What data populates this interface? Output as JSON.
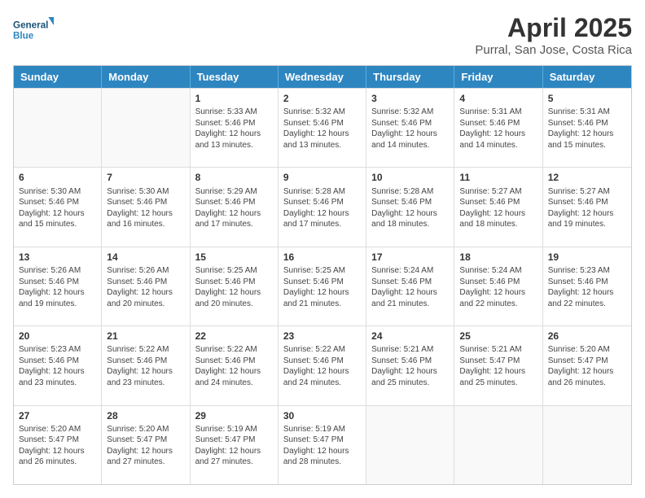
{
  "logo": {
    "line1": "General",
    "line2": "Blue"
  },
  "title": "April 2025",
  "subtitle": "Purral, San Jose, Costa Rica",
  "weekdays": [
    "Sunday",
    "Monday",
    "Tuesday",
    "Wednesday",
    "Thursday",
    "Friday",
    "Saturday"
  ],
  "rows": [
    [
      {
        "day": "",
        "info": ""
      },
      {
        "day": "",
        "info": ""
      },
      {
        "day": "1",
        "info": "Sunrise: 5:33 AM\nSunset: 5:46 PM\nDaylight: 12 hours and 13 minutes."
      },
      {
        "day": "2",
        "info": "Sunrise: 5:32 AM\nSunset: 5:46 PM\nDaylight: 12 hours and 13 minutes."
      },
      {
        "day": "3",
        "info": "Sunrise: 5:32 AM\nSunset: 5:46 PM\nDaylight: 12 hours and 14 minutes."
      },
      {
        "day": "4",
        "info": "Sunrise: 5:31 AM\nSunset: 5:46 PM\nDaylight: 12 hours and 14 minutes."
      },
      {
        "day": "5",
        "info": "Sunrise: 5:31 AM\nSunset: 5:46 PM\nDaylight: 12 hours and 15 minutes."
      }
    ],
    [
      {
        "day": "6",
        "info": "Sunrise: 5:30 AM\nSunset: 5:46 PM\nDaylight: 12 hours and 15 minutes."
      },
      {
        "day": "7",
        "info": "Sunrise: 5:30 AM\nSunset: 5:46 PM\nDaylight: 12 hours and 16 minutes."
      },
      {
        "day": "8",
        "info": "Sunrise: 5:29 AM\nSunset: 5:46 PM\nDaylight: 12 hours and 17 minutes."
      },
      {
        "day": "9",
        "info": "Sunrise: 5:28 AM\nSunset: 5:46 PM\nDaylight: 12 hours and 17 minutes."
      },
      {
        "day": "10",
        "info": "Sunrise: 5:28 AM\nSunset: 5:46 PM\nDaylight: 12 hours and 18 minutes."
      },
      {
        "day": "11",
        "info": "Sunrise: 5:27 AM\nSunset: 5:46 PM\nDaylight: 12 hours and 18 minutes."
      },
      {
        "day": "12",
        "info": "Sunrise: 5:27 AM\nSunset: 5:46 PM\nDaylight: 12 hours and 19 minutes."
      }
    ],
    [
      {
        "day": "13",
        "info": "Sunrise: 5:26 AM\nSunset: 5:46 PM\nDaylight: 12 hours and 19 minutes."
      },
      {
        "day": "14",
        "info": "Sunrise: 5:26 AM\nSunset: 5:46 PM\nDaylight: 12 hours and 20 minutes."
      },
      {
        "day": "15",
        "info": "Sunrise: 5:25 AM\nSunset: 5:46 PM\nDaylight: 12 hours and 20 minutes."
      },
      {
        "day": "16",
        "info": "Sunrise: 5:25 AM\nSunset: 5:46 PM\nDaylight: 12 hours and 21 minutes."
      },
      {
        "day": "17",
        "info": "Sunrise: 5:24 AM\nSunset: 5:46 PM\nDaylight: 12 hours and 21 minutes."
      },
      {
        "day": "18",
        "info": "Sunrise: 5:24 AM\nSunset: 5:46 PM\nDaylight: 12 hours and 22 minutes."
      },
      {
        "day": "19",
        "info": "Sunrise: 5:23 AM\nSunset: 5:46 PM\nDaylight: 12 hours and 22 minutes."
      }
    ],
    [
      {
        "day": "20",
        "info": "Sunrise: 5:23 AM\nSunset: 5:46 PM\nDaylight: 12 hours and 23 minutes."
      },
      {
        "day": "21",
        "info": "Sunrise: 5:22 AM\nSunset: 5:46 PM\nDaylight: 12 hours and 23 minutes."
      },
      {
        "day": "22",
        "info": "Sunrise: 5:22 AM\nSunset: 5:46 PM\nDaylight: 12 hours and 24 minutes."
      },
      {
        "day": "23",
        "info": "Sunrise: 5:22 AM\nSunset: 5:46 PM\nDaylight: 12 hours and 24 minutes."
      },
      {
        "day": "24",
        "info": "Sunrise: 5:21 AM\nSunset: 5:46 PM\nDaylight: 12 hours and 25 minutes."
      },
      {
        "day": "25",
        "info": "Sunrise: 5:21 AM\nSunset: 5:47 PM\nDaylight: 12 hours and 25 minutes."
      },
      {
        "day": "26",
        "info": "Sunrise: 5:20 AM\nSunset: 5:47 PM\nDaylight: 12 hours and 26 minutes."
      }
    ],
    [
      {
        "day": "27",
        "info": "Sunrise: 5:20 AM\nSunset: 5:47 PM\nDaylight: 12 hours and 26 minutes."
      },
      {
        "day": "28",
        "info": "Sunrise: 5:20 AM\nSunset: 5:47 PM\nDaylight: 12 hours and 27 minutes."
      },
      {
        "day": "29",
        "info": "Sunrise: 5:19 AM\nSunset: 5:47 PM\nDaylight: 12 hours and 27 minutes."
      },
      {
        "day": "30",
        "info": "Sunrise: 5:19 AM\nSunset: 5:47 PM\nDaylight: 12 hours and 28 minutes."
      },
      {
        "day": "",
        "info": ""
      },
      {
        "day": "",
        "info": ""
      },
      {
        "day": "",
        "info": ""
      }
    ]
  ]
}
